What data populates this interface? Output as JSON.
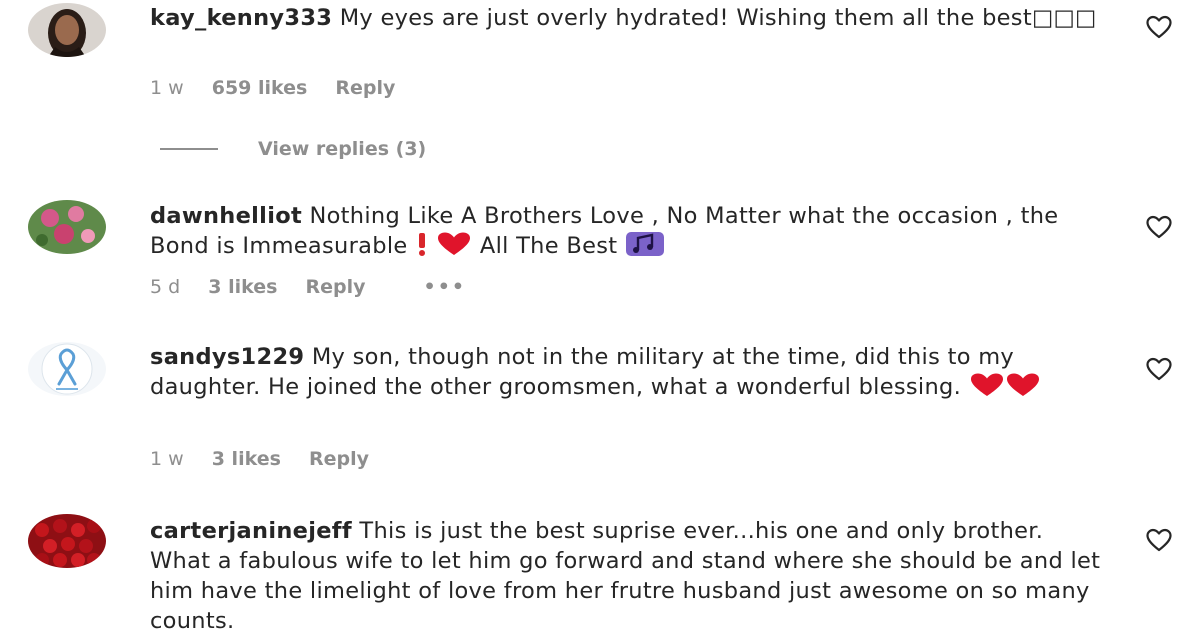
{
  "comments": [
    {
      "username": "kay_kenny333",
      "text": " My eyes are just overly hydrated! Wishing them all the best□□□",
      "time": "1 w",
      "likes": "659 likes",
      "reply": "Reply"
    },
    {
      "username": "dawnhelliot",
      "text_a": " Nothing Like A Brothers Love , No Matter what the occasion , the Bond is Immeasurable ",
      "text_b": " All The Best ",
      "time": "5 d",
      "likes": "3 likes",
      "reply": "Reply",
      "more": "•••"
    },
    {
      "username": "sandys1229",
      "text": " My son, though not in the military at the time, did this to my daughter. He joined the other groomsmen, what a wonderful blessing. ",
      "time": "1 w",
      "likes": "3 likes",
      "reply": "Reply"
    },
    {
      "username": "carterjaninejeff",
      "text": " This is just the best suprise ever...his one and only brother. What a fabulous wife to let him go forward and stand where she should be and let him have the limelight of love from her frutre husband just awesome on so many counts."
    }
  ],
  "view_replies": "View replies (3)",
  "colors": {
    "text": "#262626",
    "secondary": "#8e8e8e",
    "heart_emoji": "#e0142b"
  },
  "icons": {
    "like": "heart-outline-icon",
    "emoji_heart": "red-heart-emoji",
    "emoji_exclamation": "exclamation-emoji",
    "emoji_music": "musical-notes-emoji"
  }
}
